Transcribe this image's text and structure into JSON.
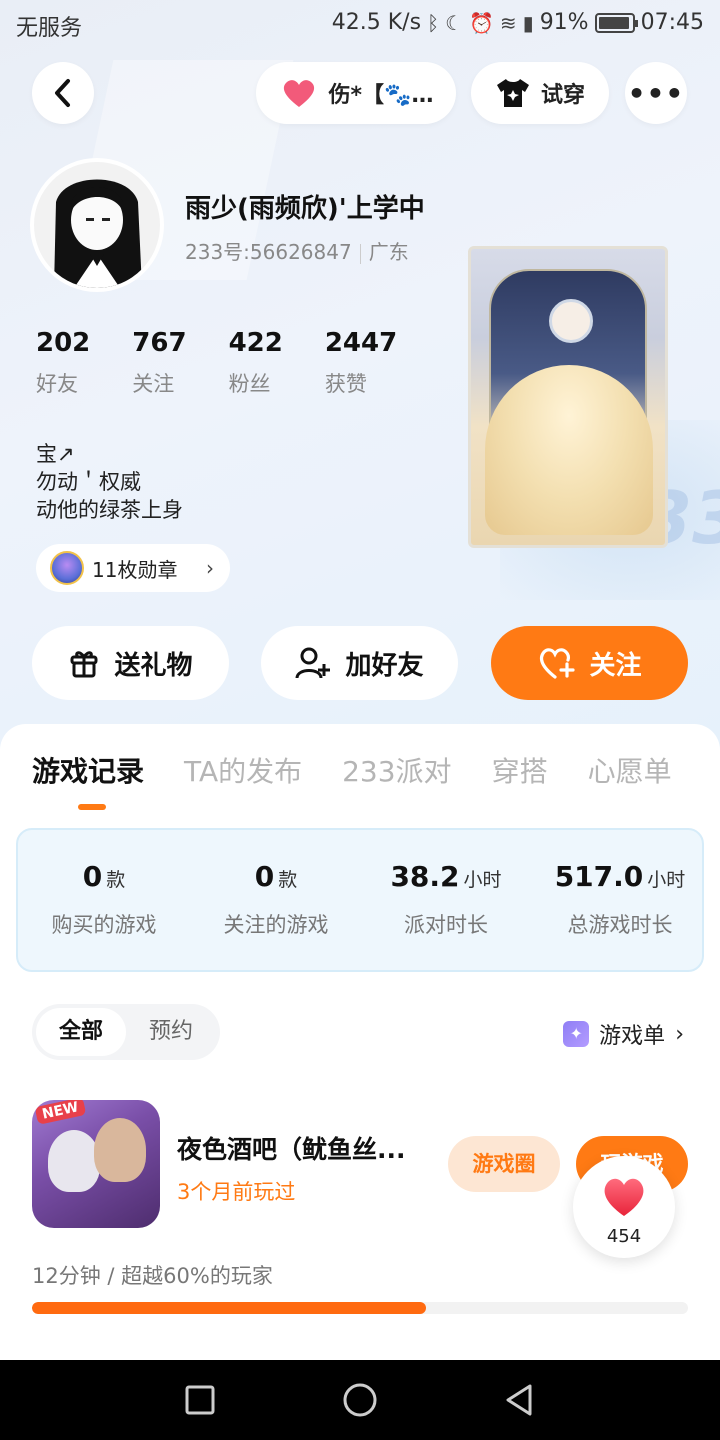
{
  "status_bar": {
    "carrier": "无服务",
    "speed": "42.5 K/s",
    "battery_pct": "91%",
    "time": "07:45"
  },
  "top_nav": {
    "title": "伤*【🐾…",
    "try_label": "试穿"
  },
  "profile": {
    "name": "雨少(雨频欣)'上学中",
    "id_text": "233号:56626847",
    "location": "广东",
    "stats": [
      {
        "num": "202",
        "label": "好友"
      },
      {
        "num": "767",
        "label": "关注"
      },
      {
        "num": "422",
        "label": "粉丝"
      },
      {
        "num": "2447",
        "label": "获赞"
      }
    ],
    "bio": [
      "宝↗",
      "勿动＇权威",
      "动他的绿茶上身"
    ],
    "badges_label": "11枚勋章"
  },
  "actions": {
    "gift": "送礼物",
    "add_friend": "加好友",
    "follow": "关注"
  },
  "tabs": [
    "游戏记录",
    "TA的发布",
    "233派对",
    "穿搭",
    "心愿单"
  ],
  "game_stats": [
    {
      "value": "0",
      "unit": "款",
      "label": "购买的游戏"
    },
    {
      "value": "0",
      "unit": "款",
      "label": "关注的游戏"
    },
    {
      "value": "38.2",
      "unit": "小时",
      "label": "派对时长"
    },
    {
      "value": "517.0",
      "unit": "小时",
      "label": "总游戏时长"
    }
  ],
  "filter": {
    "all": "全部",
    "reserve": "预约"
  },
  "game_list_label": "游戏单",
  "game": {
    "icon_badge": "NEW",
    "title": "夜色酒吧（鱿鱼丝...",
    "last_played": "3个月前玩过",
    "circle_btn": "游戏圈",
    "play_btn": "玩游戏",
    "playtime": "12分钟 / 超越60%的玩家",
    "progress_fraction": 0.6
  },
  "like": {
    "count": "454"
  },
  "colors": {
    "accent": "#ff7a14",
    "stats_box_bg": "#eef7fd"
  }
}
